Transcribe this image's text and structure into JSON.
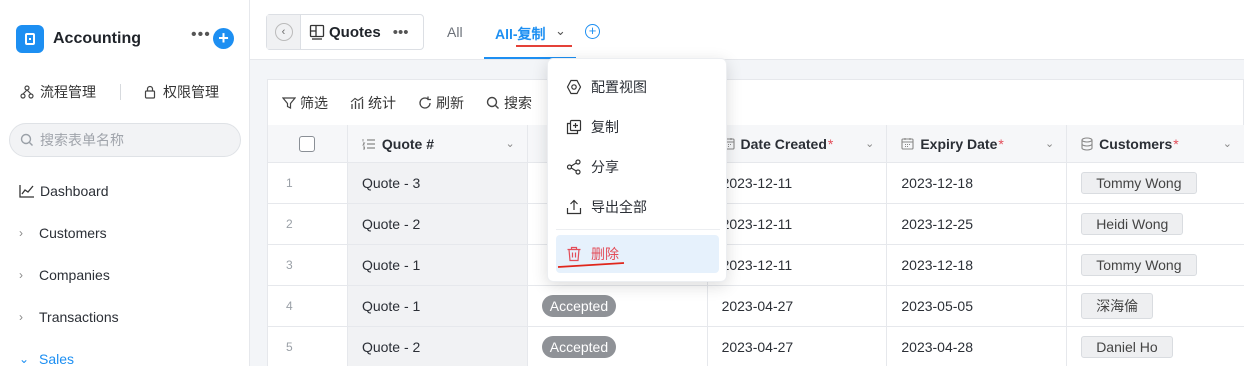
{
  "app": {
    "title": "Accounting"
  },
  "quick_links": [
    "流程管理",
    "权限管理"
  ],
  "search": {
    "placeholder": "搜索表单名称"
  },
  "nav": [
    {
      "label": "Dashboard",
      "icon": "chart-line-icon"
    },
    {
      "label": "Customers",
      "icon": "chevron-right-icon"
    },
    {
      "label": "Companies",
      "icon": "chevron-right-icon"
    },
    {
      "label": "Transactions",
      "icon": "chevron-right-icon"
    },
    {
      "label": "Sales",
      "icon": "chevron-down-icon",
      "active": true
    }
  ],
  "view": {
    "name": "Quotes"
  },
  "tabs": {
    "all": "All",
    "active": "All-复制"
  },
  "toolbar": {
    "filter": "筛选",
    "stats": "统计",
    "refresh": "刷新",
    "search": "搜索"
  },
  "columns": {
    "quote": "Quote #",
    "date_created": "Date Created",
    "expiry": "Expiry Date",
    "customers": "Customers",
    "required_mark": "*"
  },
  "rows": [
    {
      "idx": "1",
      "quote": "Quote - 3",
      "status": "",
      "date_created": "2023-12-11",
      "expiry": "2023-12-18",
      "customer": "Tommy Wong"
    },
    {
      "idx": "2",
      "quote": "Quote - 2",
      "status": "",
      "date_created": "2023-12-11",
      "expiry": "2023-12-25",
      "customer": "Heidi Wong"
    },
    {
      "idx": "3",
      "quote": "Quote - 1",
      "status": "",
      "date_created": "2023-12-11",
      "expiry": "2023-12-18",
      "customer": "Tommy Wong"
    },
    {
      "idx": "4",
      "quote": "Quote - 1",
      "status": "Accepted",
      "date_created": "2023-04-27",
      "expiry": "2023-05-05",
      "customer": "深海倫"
    },
    {
      "idx": "5",
      "quote": "Quote - 2",
      "status": "Accepted",
      "date_created": "2023-04-27",
      "expiry": "2023-04-28",
      "customer": "Daniel Ho"
    }
  ],
  "menu": {
    "configure": "配置视图",
    "copy": "复制",
    "share": "分享",
    "export": "导出全部",
    "delete": "删除"
  },
  "colors": {
    "accent": "#1d8ff2",
    "danger": "#e34d59",
    "badge": "#8f9297"
  }
}
